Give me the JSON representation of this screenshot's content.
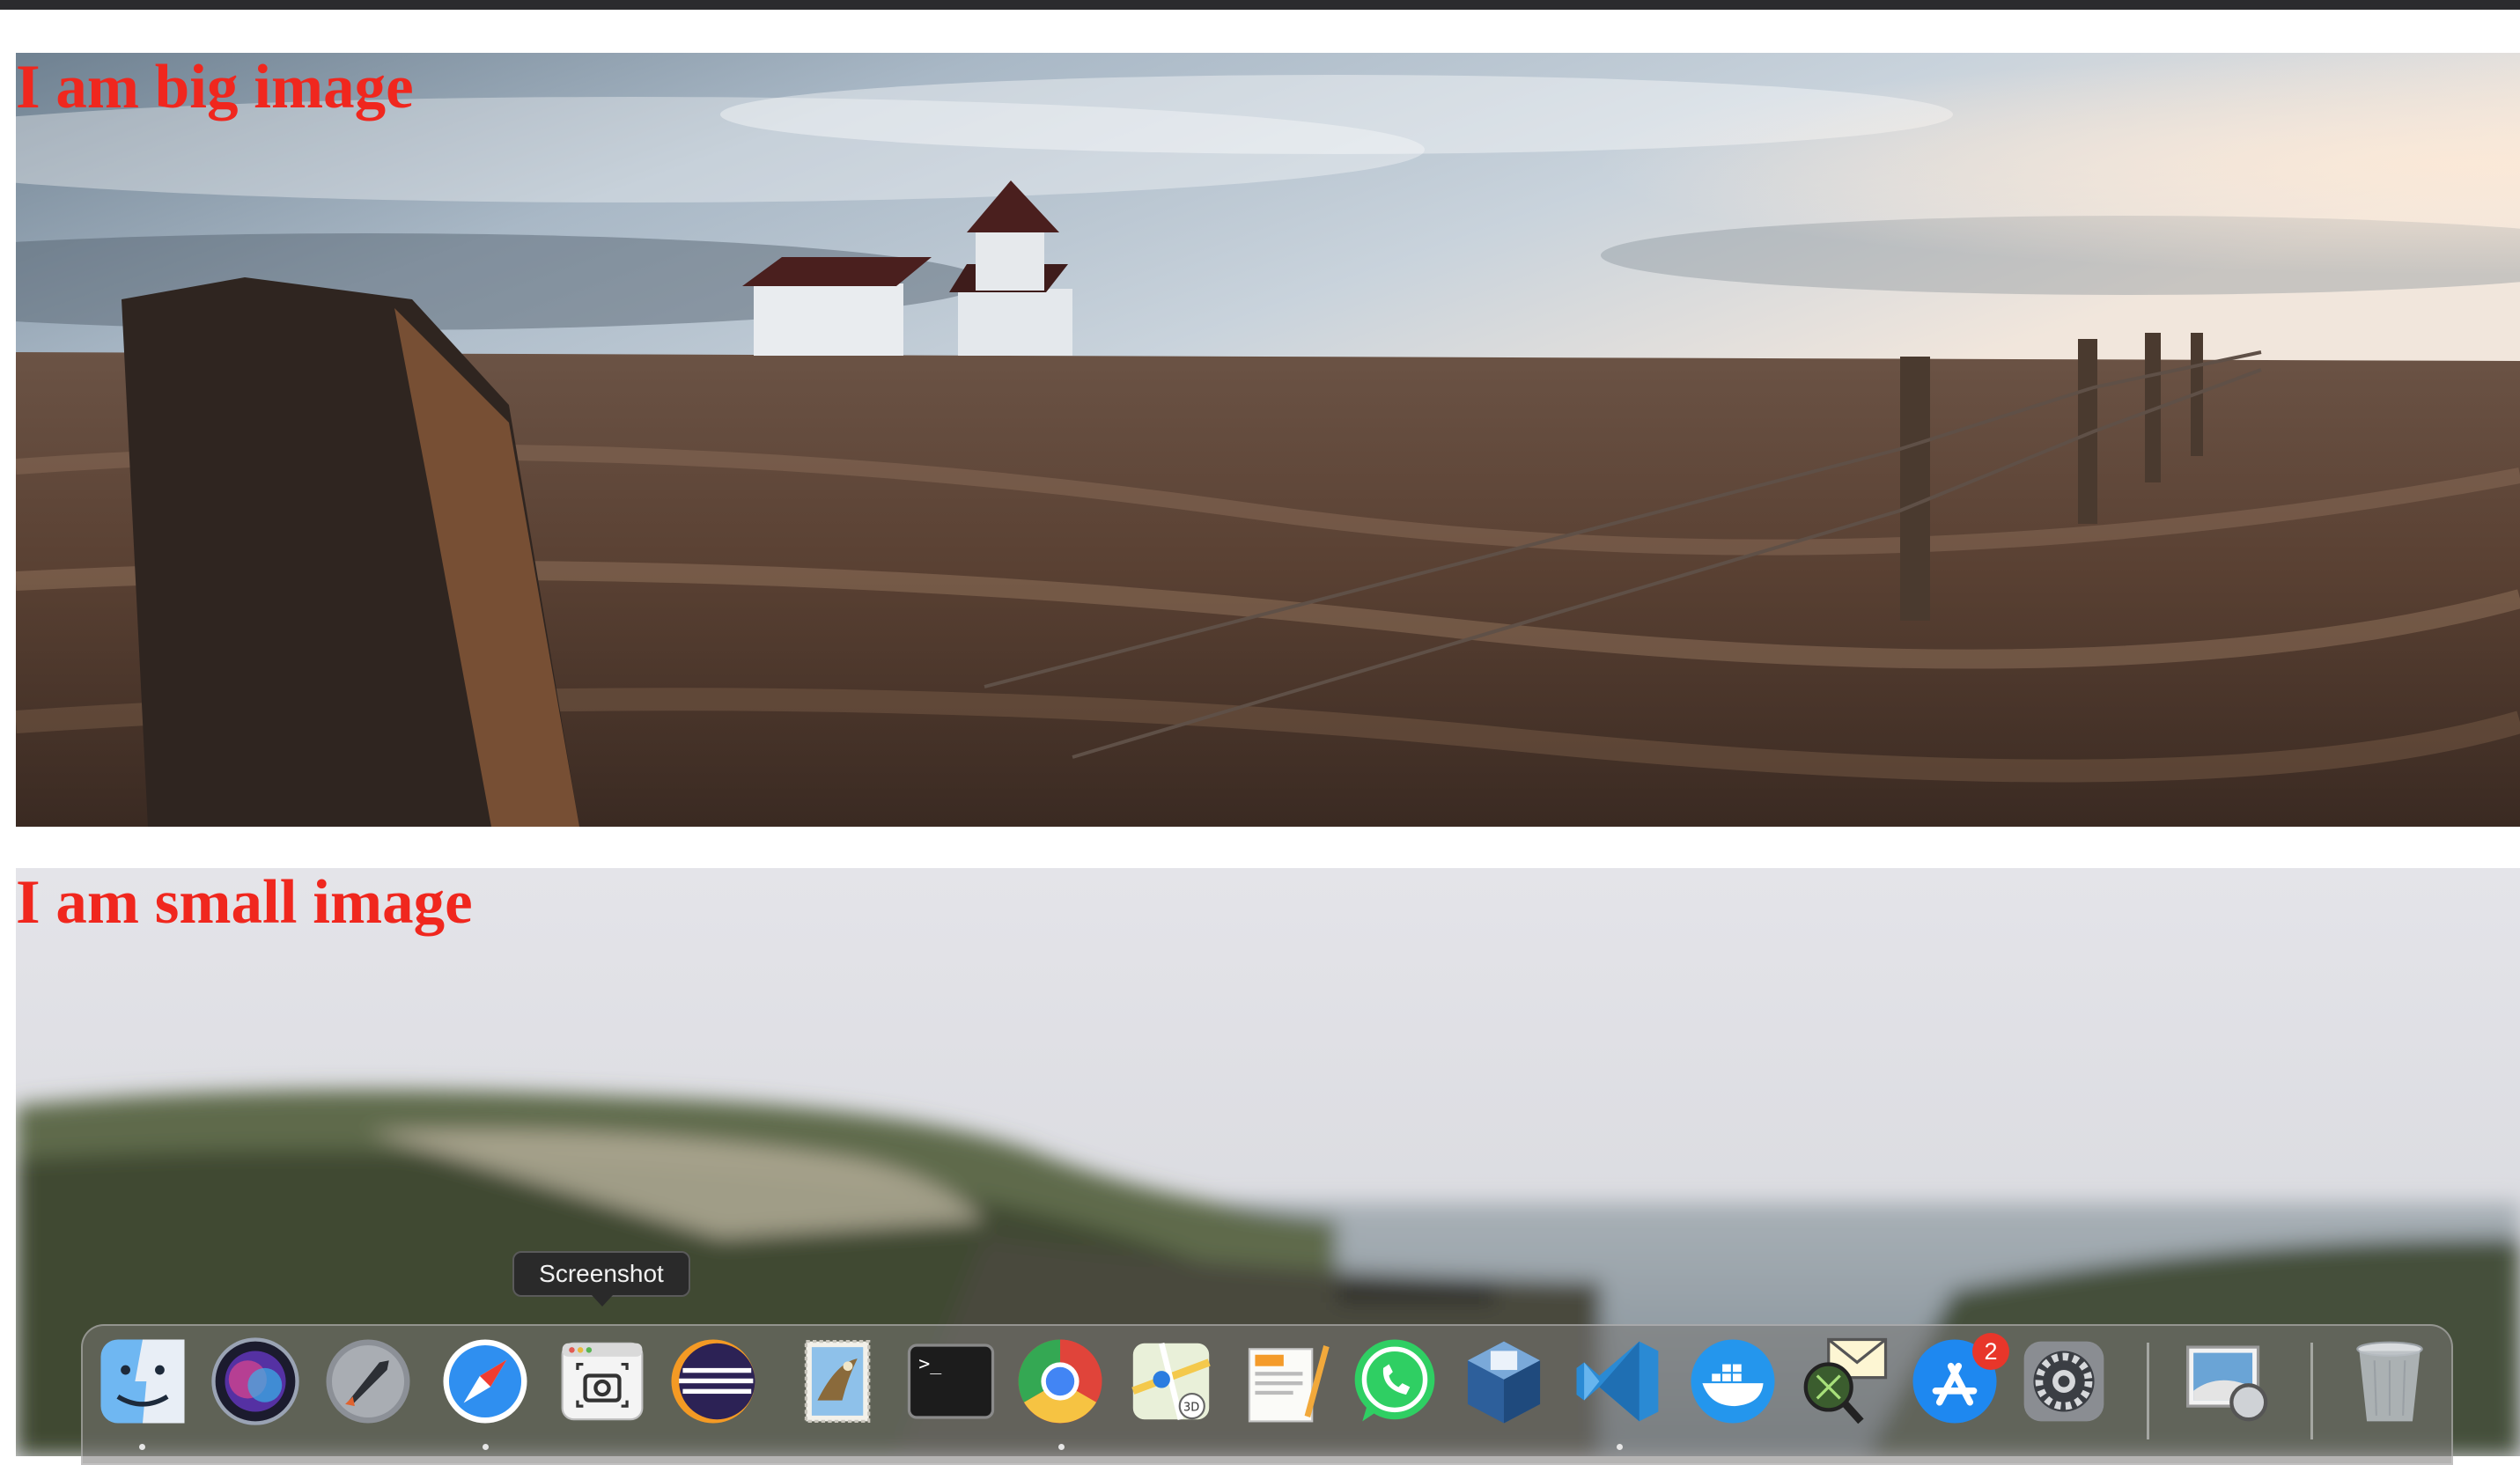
{
  "big_image": {
    "caption": "I am big image"
  },
  "small_image": {
    "caption": "I am small image"
  },
  "dock": {
    "tooltip": "Screenshot",
    "items": [
      {
        "icon": "finder-icon",
        "running": true
      },
      {
        "icon": "siri-icon",
        "running": false
      },
      {
        "icon": "launchpad-icon",
        "running": false
      },
      {
        "icon": "safari-icon",
        "running": true
      },
      {
        "icon": "screenshot-icon",
        "running": false
      },
      {
        "icon": "eclipse-icon",
        "running": false
      },
      {
        "icon": "mail-stamp-icon",
        "running": false
      },
      {
        "icon": "terminal-icon",
        "running": false
      },
      {
        "icon": "chrome-icon",
        "running": true
      },
      {
        "icon": "maps-icon",
        "running": false
      },
      {
        "icon": "pages-icon",
        "running": false
      },
      {
        "icon": "whatsapp-icon",
        "running": false
      },
      {
        "icon": "virtualbox-icon",
        "running": false
      },
      {
        "icon": "vscode-icon",
        "running": true
      },
      {
        "icon": "docker-icon",
        "running": false
      },
      {
        "icon": "mail-search-icon",
        "running": false
      },
      {
        "icon": "app-store-icon",
        "running": false,
        "badge": "2"
      },
      {
        "icon": "system-preferences-icon",
        "running": false
      },
      {
        "icon": "preview-icon",
        "running": false
      },
      {
        "icon": "trash-icon",
        "running": false
      }
    ]
  },
  "colors": {
    "caption": "#f0271e",
    "badge": "#e8362a"
  }
}
